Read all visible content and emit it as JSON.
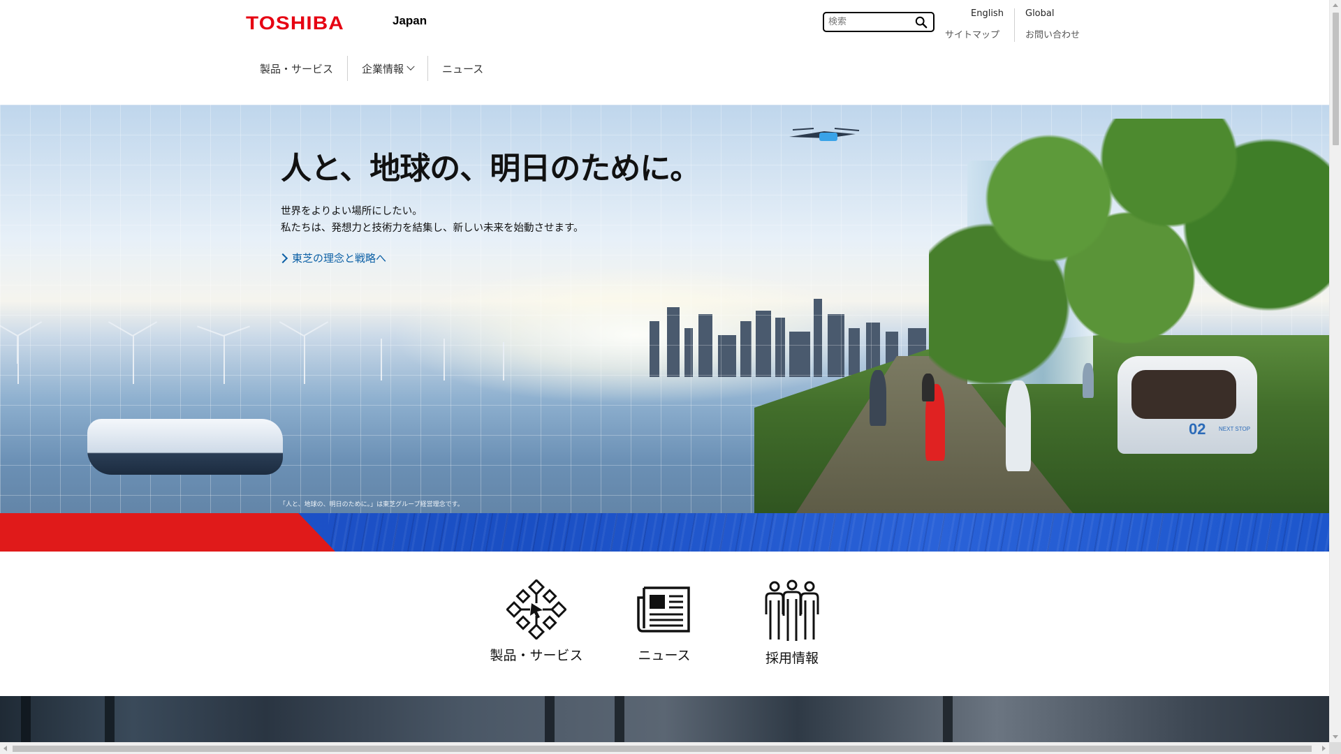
{
  "header": {
    "logo_text": "TOSHIBA",
    "region": "Japan",
    "search_placeholder": "検索",
    "utility_links": {
      "english": "English",
      "global": "Global",
      "sitemap": "サイトマップ",
      "contact": "お問い合わせ"
    },
    "nav": [
      {
        "label": "製品・サービス",
        "has_dropdown": false
      },
      {
        "label": "企業情報",
        "has_dropdown": true
      },
      {
        "label": "ニュース",
        "has_dropdown": false
      }
    ]
  },
  "hero": {
    "title": "人と、地球の、明日のために。",
    "subtitle_line1": "世界をよりよい場所にしたい。",
    "subtitle_line2": "私たちは、発想力と技術力を結集し、新しい未来を始動させます。",
    "link_label": "東芝の理念と戦略へ",
    "caption": "「人と、地球の、明日のために。」は東芝グループ経営理念です。",
    "shuttle_number": "02",
    "shuttle_sign": "NEXT STOP"
  },
  "quick_links": [
    {
      "label": "製品・サービス",
      "icon": "products-network-icon"
    },
    {
      "label": "ニュース",
      "icon": "newspaper-icon"
    },
    {
      "label": "採用情報",
      "icon": "people-group-icon"
    }
  ],
  "colors": {
    "brand_red": "#e60012",
    "band_red": "#e01a1a",
    "band_blue": "#1f53c9",
    "link_blue": "#0b5fa5"
  }
}
